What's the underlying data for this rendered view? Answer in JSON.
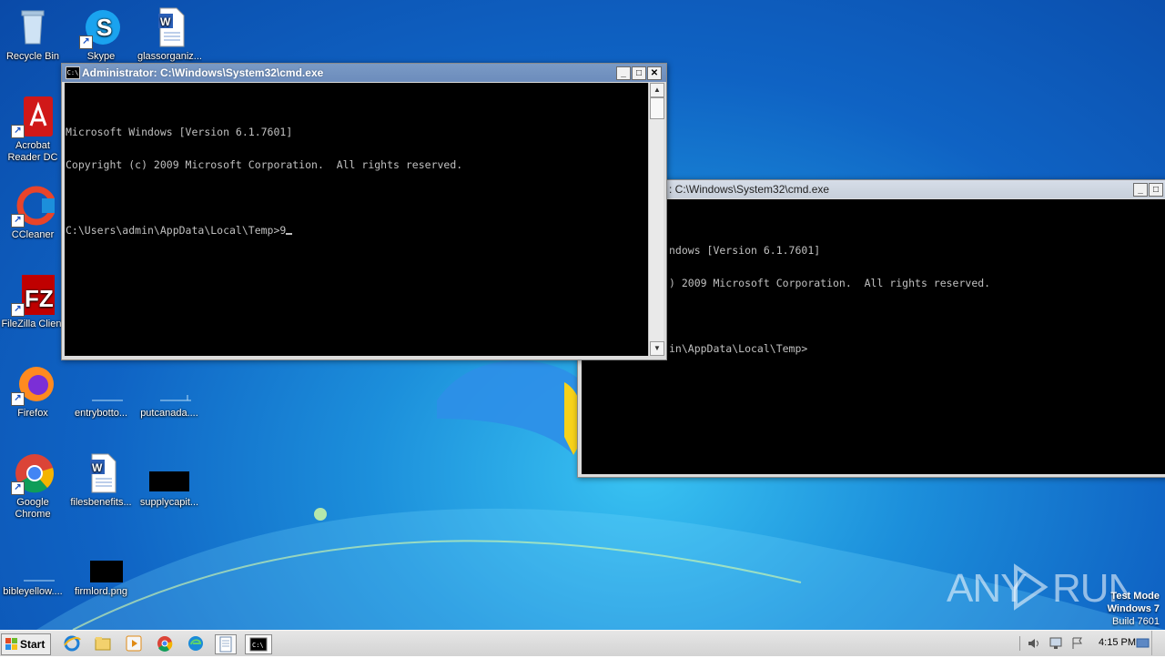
{
  "desktop": {
    "icons": [
      {
        "label": "Recycle Bin"
      },
      {
        "label": "Skype"
      },
      {
        "label": "glassorganiz..."
      },
      {
        "label": "Acrobat Reader DC"
      },
      {
        "label": "CCleaner"
      },
      {
        "label": "FileZilla Client"
      },
      {
        "label": "Firefox"
      },
      {
        "label": "entrybotto..."
      },
      {
        "label": "putcanada...."
      },
      {
        "label": "Google Chrome"
      },
      {
        "label": "filesbenefits..."
      },
      {
        "label": "supplycapit..."
      },
      {
        "label": "bibleyellow...."
      },
      {
        "label": "firmlord.png"
      }
    ]
  },
  "window_front": {
    "title": "Administrator: C:\\Windows\\System32\\cmd.exe",
    "console_lines": [
      "Microsoft Windows [Version 6.1.7601]",
      "Copyright (c) 2009 Microsoft Corporation.  All rights reserved.",
      "",
      "C:\\Users\\admin\\AppData\\Local\\Temp>9"
    ]
  },
  "window_back": {
    "title": ": C:\\Windows\\System32\\cmd.exe",
    "console_lines": [
      "ndows [Version 6.1.7601]",
      ") 2009 Microsoft Corporation.  All rights reserved.",
      "",
      "in\\AppData\\Local\\Temp>"
    ]
  },
  "watermark": {
    "text": "ANY RUN"
  },
  "system_info": {
    "line1": "Test Mode",
    "line2": "Windows 7",
    "line3": "Build 7601"
  },
  "taskbar": {
    "start_label": "Start",
    "clock": "4:15 PM",
    "pinned": [
      "internet-explorer-icon",
      "explorer-icon",
      "media-player-icon",
      "chrome-icon",
      "edge-icon",
      "notepad-icon",
      "cmd-icon"
    ]
  },
  "colors": {
    "console_bg": "#000000",
    "console_fg": "#c0c0c0",
    "titlebar_active": "#6c8cbc",
    "desktop_blue": "#1c8fdb"
  }
}
